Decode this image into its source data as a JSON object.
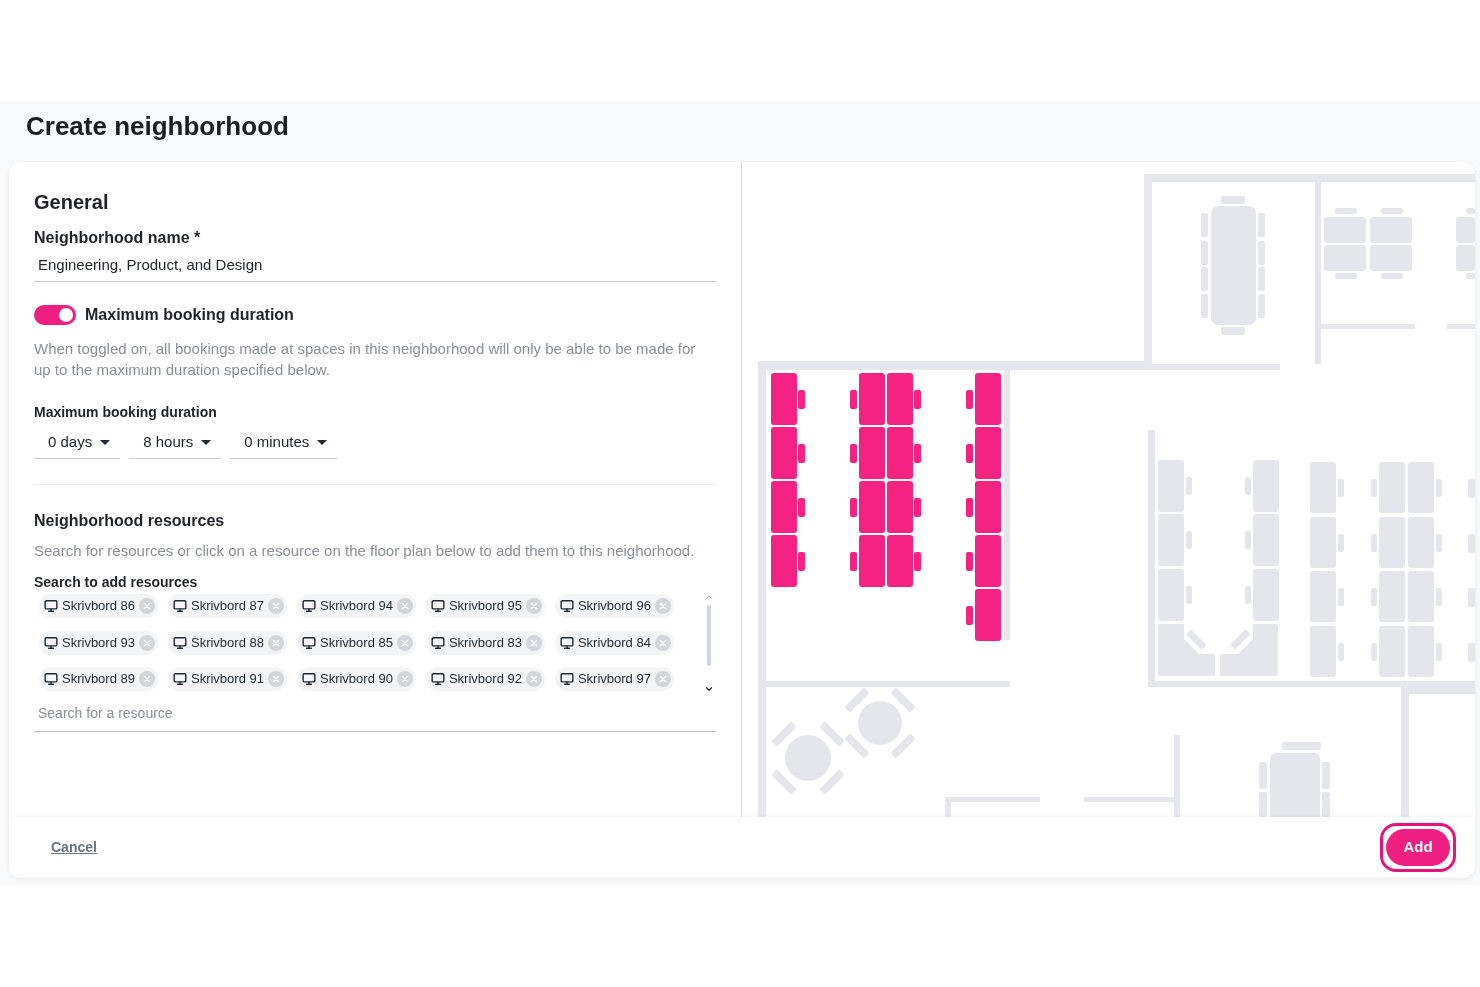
{
  "page": {
    "title": "Create neighborhood"
  },
  "general": {
    "heading": "General",
    "name_field": {
      "label": "Neighborhood name *",
      "value": "Engineering, Product, and Design"
    },
    "max_duration_toggle": {
      "label": "Maximum booking duration",
      "on": true
    },
    "description": "When toggled on, all bookings made at spaces in this neighborhood will only be able to be made for up to the maximum duration specified below.",
    "duration": {
      "label": "Maximum booking duration",
      "selects": [
        {
          "value": "0 days"
        },
        {
          "value": "8 hours"
        },
        {
          "value": "0 minutes"
        }
      ]
    }
  },
  "resources": {
    "heading": "Neighborhood resources",
    "description": "Search for resources or click on a resource on the floor plan below to add them to this neighorhood.",
    "search": {
      "label": "Search to add resources",
      "chips": [
        "Skrivbord 86",
        "Skrivbord 87",
        "Skrivbord 94",
        "Skrivbord 95",
        "Skrivbord 96",
        "Skrivbord 93",
        "Skrivbord 88",
        "Skrivbord 85",
        "Skrivbord 83",
        "Skrivbord 84",
        "Skrivbord 89",
        "Skrivbord 91",
        "Skrivbord 90",
        "Skrivbord 92",
        "Skrivbord 97"
      ],
      "placeholder": "Search for a resource"
    }
  },
  "floor_plan": {
    "desks": [
      {
        "selected": true
      },
      {
        "selected": true
      },
      {
        "selected": true
      },
      {
        "selected": true
      },
      {
        "selected": true
      },
      {
        "selected": true
      },
      {
        "selected": true
      },
      {
        "selected": true
      },
      {
        "selected": true
      },
      {
        "selected": true
      },
      {
        "selected": true
      },
      {
        "selected": true
      },
      {
        "selected": true
      },
      {
        "selected": true
      },
      {
        "selected": true
      },
      {
        "selected": true
      },
      {
        "selected": true
      },
      {
        "selected": false
      },
      {
        "selected": false
      },
      {
        "selected": false
      },
      {
        "selected": false
      },
      {
        "selected": false
      },
      {
        "selected": false
      },
      {
        "selected": false
      },
      {
        "selected": false
      },
      {
        "selected": false
      },
      {
        "selected": false
      },
      {
        "selected": false
      },
      {
        "selected": false
      },
      {
        "selected": false
      },
      {
        "selected": false
      },
      {
        "selected": false
      },
      {
        "selected": false
      },
      {
        "selected": false
      },
      {
        "selected": false
      },
      {
        "selected": false
      },
      {
        "selected": false
      },
      {
        "selected": false
      },
      {
        "selected": false
      },
      {
        "selected": false
      },
      {
        "selected": false
      }
    ]
  },
  "footer": {
    "cancel": "Cancel",
    "add": "Add"
  }
}
